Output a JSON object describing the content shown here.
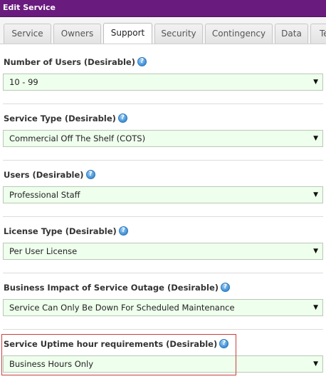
{
  "window": {
    "title": "Edit Service"
  },
  "tabs": [
    {
      "label": "Service",
      "active": false
    },
    {
      "label": "Owners",
      "active": false
    },
    {
      "label": "Support",
      "active": true
    },
    {
      "label": "Security",
      "active": false
    },
    {
      "label": "Contingency",
      "active": false
    },
    {
      "label": "Data",
      "active": false
    },
    {
      "label": "Te",
      "active": false
    }
  ],
  "help_icon_glyph": "?",
  "dropdown_arrow_glyph": "▼",
  "fields": [
    {
      "label": "Number of Users (Desirable)",
      "value": "10 - 99"
    },
    {
      "label": "Service Type (Desirable)",
      "value": "Commercial Off The Shelf (COTS)"
    },
    {
      "label": "Users (Desirable)",
      "value": "Professional Staff"
    },
    {
      "label": "License Type (Desirable)",
      "value": "Per User License"
    },
    {
      "label": "Business Impact of Service Outage (Desirable)",
      "value": "Service Can Only Be Down For Scheduled Maintenance"
    },
    {
      "label": "Service Uptime hour requirements (Desirable)",
      "value": "Business Hours Only"
    }
  ],
  "colors": {
    "title_bar": "#6a1b7e",
    "select_background": "#efffed",
    "highlight_border": "#c9403e"
  }
}
